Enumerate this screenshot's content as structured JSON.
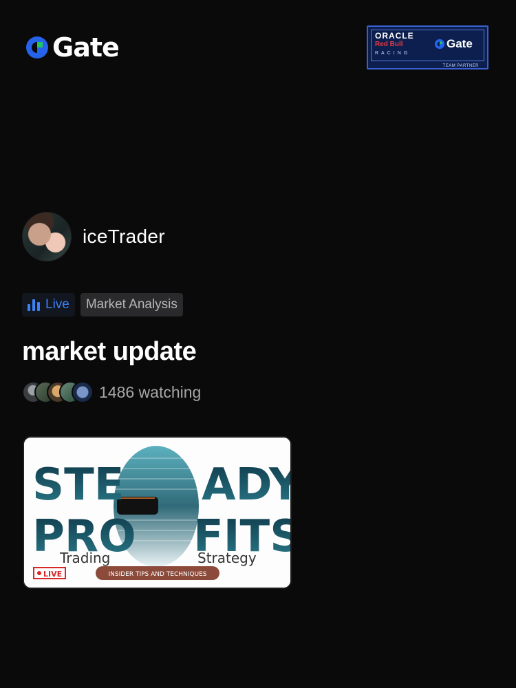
{
  "header": {
    "logo_text": "Gate",
    "logo_icon": "gate-logo-icon",
    "partner": {
      "line1": "ORACLE",
      "line2": "Red Bull",
      "line3": "RACING",
      "brand": "Gate",
      "caption": "TEAM PARTNER"
    }
  },
  "streamer": {
    "username": "iceTrader"
  },
  "tags": {
    "live_label": "Live",
    "live_icon": "bar-chart-icon",
    "category": "Market Analysis"
  },
  "stream": {
    "title": "market update",
    "watching": "1486 watching"
  },
  "thumbnail": {
    "word1_left": "STE",
    "word1_right": "ADY",
    "word2_left": "PRO",
    "word2_right": "FITS",
    "sub_left": "Trading",
    "sub_right": "Strategy",
    "live_badge": "LIVE",
    "banner": "INSIDER TIPS AND TECHNIQUES"
  },
  "colors": {
    "background": "#0a0a0a",
    "accent_blue": "#3b82f6",
    "gate_green": "#22c55e",
    "thumb_text": "#0f3a4a"
  }
}
